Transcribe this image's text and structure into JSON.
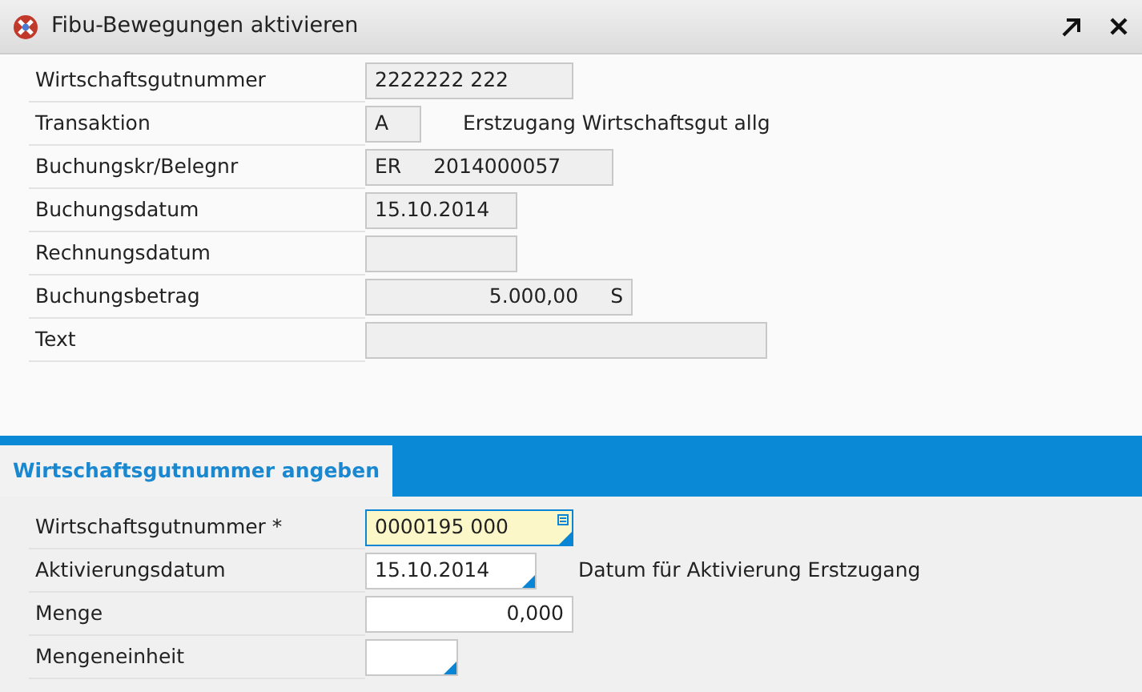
{
  "window": {
    "title": "Fibu-Bewegungen aktivieren"
  },
  "details": [
    {
      "label": "Wirtschaftsgutnummer",
      "parts": [
        "2222222 222"
      ]
    },
    {
      "label": "Transaktion",
      "parts": [
        "A"
      ],
      "description": "Erstzugang Wirtschaftsgut allg"
    },
    {
      "label": "Buchungskr/Belegnr",
      "parts": [
        "ER",
        "2014000057"
      ]
    },
    {
      "label": "Buchungsdatum",
      "parts": [
        "15.10.2014"
      ]
    },
    {
      "label": "Rechnungsdatum"
    },
    {
      "label": "Buchungsbetrag",
      "parts": [
        "5.000,00",
        "S"
      ]
    },
    {
      "label": "Text"
    }
  ],
  "tabs": [
    {
      "label": "Wirtschaftsgutnummer angeben",
      "selected": true
    }
  ],
  "inputs": [
    {
      "label": "Wirtschaftsgutnummer *",
      "value": "0000195 000",
      "focused": true,
      "value_help": true,
      "list_button": true
    },
    {
      "label": "Aktivierungsdatum",
      "value": "15.10.2014",
      "focused": false,
      "value_help": true,
      "list_button": false,
      "description": "Datum für Aktivierung Erstzugang"
    },
    {
      "label": "Menge",
      "value": "0,000",
      "focused": false,
      "value_help": false,
      "list_button": false
    },
    {
      "label": "Mengeneinheit",
      "focused": false,
      "value_help": true,
      "list_button": false
    }
  ]
}
